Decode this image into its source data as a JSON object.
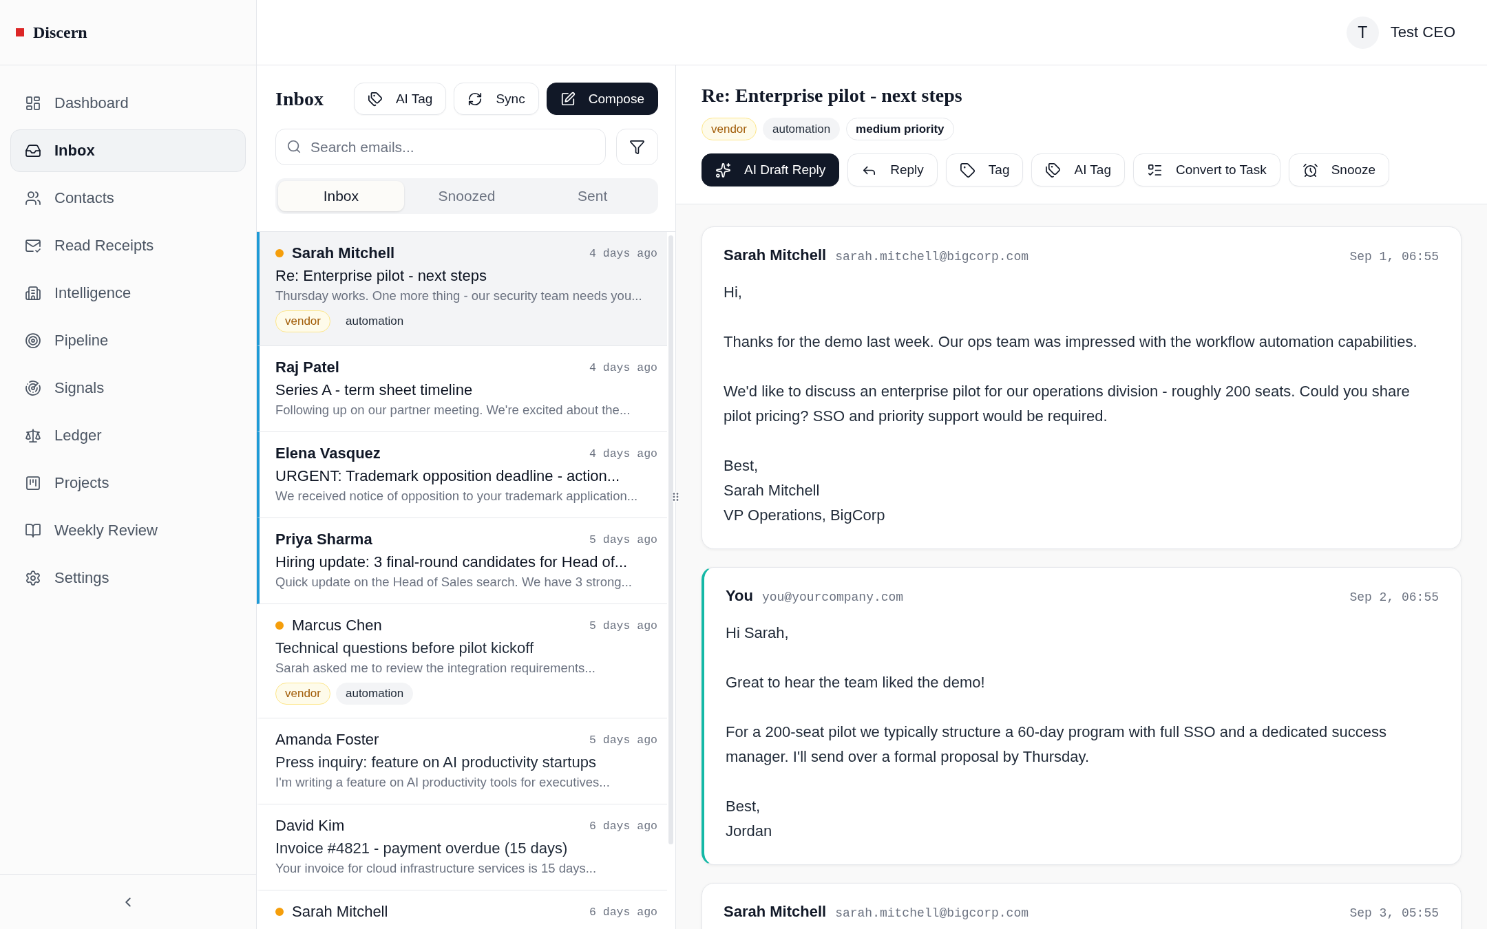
{
  "sidebar": {
    "app_name": "Discern",
    "items": [
      {
        "label": "Dashboard",
        "selected": false
      },
      {
        "label": "Inbox",
        "selected": true
      },
      {
        "label": "Contacts",
        "selected": false
      },
      {
        "label": "Read Receipts",
        "selected": false
      },
      {
        "label": "Intelligence",
        "selected": false
      },
      {
        "label": "Pipeline",
        "selected": false
      },
      {
        "label": "Signals",
        "selected": false
      },
      {
        "label": "Ledger",
        "selected": false
      },
      {
        "label": "Projects",
        "selected": false
      },
      {
        "label": "Weekly Review",
        "selected": false
      },
      {
        "label": "Settings",
        "selected": false
      }
    ]
  },
  "top_bar": {
    "avatar_initial": "T",
    "user_name": "Test CEO"
  },
  "inbox": {
    "title": "Inbox",
    "buttons": [
      {
        "label": "AI Tag",
        "kind": "outline"
      },
      {
        "label": "Sync",
        "kind": "outline"
      },
      {
        "label": "Compose",
        "kind": "primary"
      }
    ],
    "search": {
      "placeholder": "Search emails..."
    },
    "tabs": [
      {
        "label": "Inbox",
        "selected": true
      },
      {
        "label": "Snoozed",
        "selected": false
      },
      {
        "label": "Sent",
        "selected": false
      }
    ],
    "emails": [
      {
        "sender": "Sarah Mitchell",
        "time": "4 days ago",
        "subject": "Re: Enterprise pilot - next steps",
        "preview": "Thursday works. One more thing - our security team needs you...",
        "unread": true,
        "dot": true,
        "selected": true,
        "tags": [
          {
            "label": "vendor",
            "kind": "vendor"
          },
          {
            "label": "automation",
            "kind": "topic"
          }
        ]
      },
      {
        "sender": "Raj Patel",
        "time": "4 days ago",
        "subject": "Series A - term sheet timeline",
        "preview": "Following up on our partner meeting. We're excited about the...",
        "unread": true,
        "dot": false,
        "selected": false
      },
      {
        "sender": "Elena Vasquez",
        "time": "4 days ago",
        "subject": "URGENT: Trademark opposition deadline - action...",
        "preview": "We received notice of opposition to your trademark application...",
        "unread": true,
        "dot": false,
        "selected": false
      },
      {
        "sender": "Priya Sharma",
        "time": "5 days ago",
        "subject": "Hiring update: 3 final-round candidates for Head of...",
        "preview": "Quick update on the Head of Sales search. We have 3 strong...",
        "unread": true,
        "dot": false,
        "selected": false
      },
      {
        "sender": "Marcus Chen",
        "time": "5 days ago",
        "subject": "Technical questions before pilot kickoff",
        "preview": "Sarah asked me to review the integration requirements...",
        "unread": false,
        "dot": true,
        "selected": false,
        "tags": [
          {
            "label": "vendor",
            "kind": "vendor"
          },
          {
            "label": "automation",
            "kind": "topic"
          }
        ]
      },
      {
        "sender": "Amanda Foster",
        "time": "5 days ago",
        "subject": "Press inquiry: feature on AI productivity startups",
        "preview": "I'm writing a feature on AI productivity tools for executives...",
        "unread": false,
        "dot": false,
        "selected": false
      },
      {
        "sender": "David Kim",
        "time": "6 days ago",
        "subject": "Invoice #4821 - payment overdue (15 days)",
        "preview": "Your invoice for cloud infrastructure services is 15 days...",
        "unread": false,
        "dot": false,
        "selected": false
      },
      {
        "sender": "Sarah Mitchell",
        "time": "6 days ago",
        "unread": false,
        "dot": true,
        "selected": false
      }
    ]
  },
  "message_view": {
    "subject": "Re: Enterprise pilot - next steps",
    "tags": [
      {
        "label": "vendor",
        "kind": "vendor"
      },
      {
        "label": "automation",
        "kind": "topic"
      },
      {
        "label": "medium priority",
        "kind": "priority"
      }
    ],
    "actions": [
      {
        "label": "AI Draft Reply",
        "kind": "primary"
      },
      {
        "label": "Reply",
        "kind": "outline"
      },
      {
        "label": "Tag",
        "kind": "outline"
      },
      {
        "label": "AI Tag",
        "kind": "outline"
      },
      {
        "label": "Convert to Task",
        "kind": "outline"
      },
      {
        "label": "Snooze",
        "kind": "outline"
      }
    ],
    "messages": [
      {
        "sender": "Sarah Mitchell",
        "email": "sarah.mitchell@bigcorp.com",
        "date": "Sep 1, 06:55",
        "outgoing": false,
        "paragraphs": [
          [
            "Hi,"
          ],
          [
            "Thanks for the demo last week. Our ops team was impressed with the workflow automation capabilities."
          ],
          [
            "We'd like to discuss an enterprise pilot for our operations division - roughly 200 seats. Could you share pilot pricing? SSO and priority support would be required."
          ],
          [
            "Best,",
            "Sarah Mitchell",
            "VP Operations, BigCorp"
          ]
        ]
      },
      {
        "sender": "You",
        "email": "you@yourcompany.com",
        "date": "Sep 2, 06:55",
        "outgoing": true,
        "paragraphs": [
          [
            "Hi Sarah,"
          ],
          [
            "Great to hear the team liked the demo!"
          ],
          [
            "For a 200-seat pilot we typically structure a 60-day program with full SSO and a dedicated success manager. I'll send over a formal proposal by Thursday."
          ],
          [
            "Best,",
            "Jordan"
          ]
        ]
      },
      {
        "sender": "Sarah Mitchell",
        "email": "sarah.mitchell@bigcorp.com",
        "date": "Sep 3, 05:55",
        "outgoing": false
      }
    ]
  }
}
